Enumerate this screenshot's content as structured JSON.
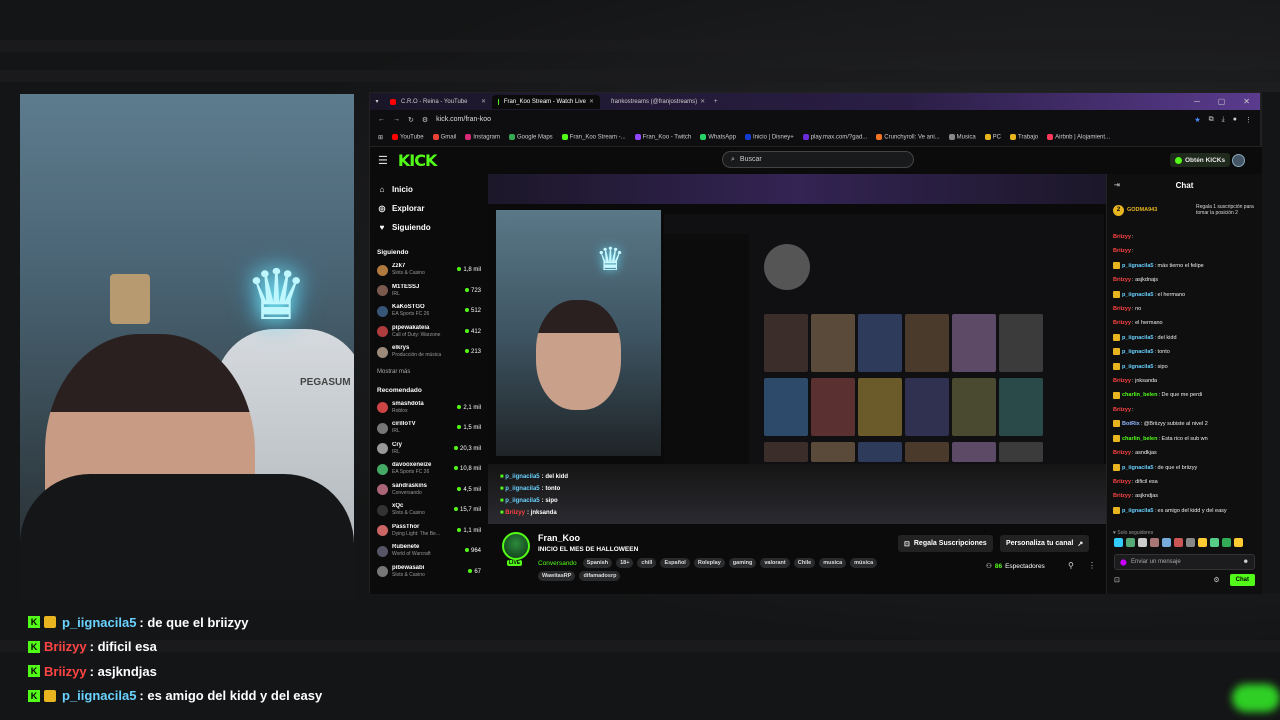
{
  "overlay_chat": [
    {
      "user": "p_iignacila5",
      "color": "blue",
      "crown": true,
      "msg": ": de que el briizyy"
    },
    {
      "user": "Briizyy",
      "color": "red",
      "crown": false,
      "msg": ": dificil esa"
    },
    {
      "user": "Briizyy",
      "color": "red",
      "crown": false,
      "msg": ": asjkndjas"
    },
    {
      "user": "p_iignacila5",
      "color": "blue",
      "crown": true,
      "msg": ": es amigo del kidd y del easy"
    }
  ],
  "webcam": {
    "chair_brand": "PEGASUM"
  },
  "browser": {
    "tabs": [
      {
        "label": "C.R.O - Reina - YouTube",
        "active": false
      },
      {
        "label": "Fran_Koo Stream - Watch Live",
        "active": true
      },
      {
        "label": "frankostreams (@franjostreams)",
        "active": false
      }
    ],
    "url": "kick.com/fran-koo",
    "bookmarks": [
      "YouTube",
      "Gmail",
      "Instagram",
      "Google Maps",
      "Fran_Koo Stream -...",
      "Fran_Koo - Twitch",
      "WhatsApp",
      "Inicio | Disney+",
      "play.max.com/?gad...",
      "Crunchyroll: Ve ani...",
      "Musica",
      "PC",
      "Trabajo",
      "Airbnb | Alojamient..."
    ]
  },
  "kick": {
    "logo": "KICK",
    "search_placeholder": "Buscar",
    "get_kicks": "Obtén KICKs",
    "nav": [
      {
        "label": "Inicio",
        "icon": "home-icon"
      },
      {
        "label": "Explorar",
        "icon": "compass-icon"
      },
      {
        "label": "Siguiendo",
        "icon": "heart-icon"
      }
    ],
    "following_title": "Siguiendo",
    "following": [
      {
        "name": "Zzk7",
        "cat": "Slots & Casino",
        "viewers": "1,8 mil",
        "color": "#b0793d"
      },
      {
        "name": "M1TESSJ",
        "cat": "IRL",
        "viewers": "723",
        "color": "#7a5a4d"
      },
      {
        "name": "KaKoSTGO",
        "cat": "EA Sports FC 26",
        "viewers": "512",
        "color": "#365577"
      },
      {
        "name": "pipewakateia",
        "cat": "Call of Duty: Warzone",
        "viewers": "412",
        "color": "#b03d3d"
      },
      {
        "name": "elkrys",
        "cat": "Producción de música",
        "viewers": "213",
        "color": "#9b8a7a"
      }
    ],
    "show_more": "Mostrar más",
    "recommended_title": "Recomendado",
    "recommended": [
      {
        "name": "smashdota",
        "cat": "Roblox",
        "viewers": "2,1 mil",
        "color": "#c44"
      },
      {
        "name": "cirilloTV",
        "cat": "IRL",
        "viewers": "1,5 mil",
        "color": "#777"
      },
      {
        "name": "Cry",
        "cat": "IRL",
        "viewers": "20,3 mil",
        "color": "#999"
      },
      {
        "name": "davooxeneize",
        "cat": "EA Sports FC 26",
        "viewers": "10,8 mil",
        "color": "#4a6"
      },
      {
        "name": "sandraskins",
        "cat": "Conversando",
        "viewers": "4,5 mil",
        "color": "#a67"
      },
      {
        "name": "xQc",
        "cat": "Slots & Casino",
        "viewers": "15,7 mil",
        "color": "#333"
      },
      {
        "name": "PassThor",
        "cat": "Dying Light: The Be...",
        "viewers": "1,1 mil",
        "color": "#c66"
      },
      {
        "name": "Rubenete",
        "cat": "World of Warcraft",
        "viewers": "964",
        "color": "#556"
      },
      {
        "name": "pibewasabi",
        "cat": "Slots & Casino",
        "viewers": "67",
        "color": "#777"
      }
    ],
    "mini_chat": [
      {
        "user": "p_iignacila5",
        "color": "blue",
        "msg": ": del kidd"
      },
      {
        "user": "p_iignacila5",
        "color": "blue",
        "msg": ": tonto"
      },
      {
        "user": "p_iignacila5",
        "color": "blue",
        "msg": ": sipo"
      },
      {
        "user": "Briizyy",
        "color": "red",
        "msg": ": jnksanda"
      }
    ],
    "stream": {
      "streamer": "Fran_Koo",
      "title": "INICIO EL MES DE HALLOWEEN",
      "category": "Conversando",
      "tags": [
        "Spanish",
        "18+",
        "chill",
        "Español",
        "Roleplay",
        "gaming",
        "valorant",
        "Chile",
        "musica",
        "música"
      ],
      "tags2": [
        "WawitasRP",
        "difamadosrp"
      ],
      "live": "LIVE",
      "subs_button": "Regala Suscripciones",
      "customize_button": "Personaliza tu canal",
      "viewers": "86",
      "viewers_label": "Espectadores"
    },
    "chat": {
      "title": "Chat",
      "pinned_user": "GODMA943",
      "pinned_count": "2",
      "pinned_text": "Regala 1 suscripción para tomar la posición 2",
      "messages": [
        {
          "user": "Briizyy",
          "color": "r",
          "msg": ":",
          "badge": false
        },
        {
          "user": "Briizyy",
          "color": "r",
          "msg": ":",
          "badge": false
        },
        {
          "user": "p_iignacila5",
          "color": "b",
          "msg": ": más tierno el felipe",
          "badge": true
        },
        {
          "user": "Briizyy",
          "color": "r",
          "msg": ": asjkdnajs",
          "badge": false
        },
        {
          "user": "p_iignacila5",
          "color": "b",
          "msg": ": el hermano",
          "badge": true
        },
        {
          "user": "Briizyy",
          "color": "r",
          "msg": ": no",
          "badge": false
        },
        {
          "user": "Briizyy",
          "color": "r",
          "msg": ": el hermano",
          "badge": false
        },
        {
          "user": "p_iignacila5",
          "color": "b",
          "msg": ": del kidd",
          "badge": true
        },
        {
          "user": "p_iignacila5",
          "color": "b",
          "msg": ": tonto",
          "badge": true
        },
        {
          "user": "p_iignacila5",
          "color": "b",
          "msg": ": sipo",
          "badge": true
        },
        {
          "user": "Briizyy",
          "color": "r",
          "msg": ": jnksanda",
          "badge": false
        },
        {
          "user": "charlin_belen",
          "color": "g",
          "msg": ": De que me perdi",
          "badge": true
        },
        {
          "user": "Briizyy",
          "color": "r",
          "msg": ":",
          "badge": false
        },
        {
          "user": "BotRix",
          "color": "l",
          "msg": ": @Briizyy subiste al nivel 2",
          "badge": true
        },
        {
          "user": "charlin_belen",
          "color": "g",
          "msg": ": Esta rico el sub wn",
          "badge": true
        },
        {
          "user": "Briizyy",
          "color": "r",
          "msg": ": asndkjas",
          "badge": false
        },
        {
          "user": "p_iignacila5",
          "color": "b",
          "msg": ": de que el briizyy",
          "badge": true
        },
        {
          "user": "Briizyy",
          "color": "r",
          "msg": ": dificil esa",
          "badge": false
        },
        {
          "user": "Briizyy",
          "color": "r",
          "msg": ": asjkndjas",
          "badge": false
        },
        {
          "user": "p_iignacila5",
          "color": "b",
          "msg": ": es amigo del kidd y del easy",
          "badge": true
        }
      ],
      "followers_only": "Solo seguidores",
      "input_placeholder": "Enviar un mensaje",
      "send_button": "Chat"
    }
  },
  "colors": {
    "kick_green": "#53fc18",
    "user_blue": "#6ad2ff",
    "user_red": "#ff4444"
  }
}
